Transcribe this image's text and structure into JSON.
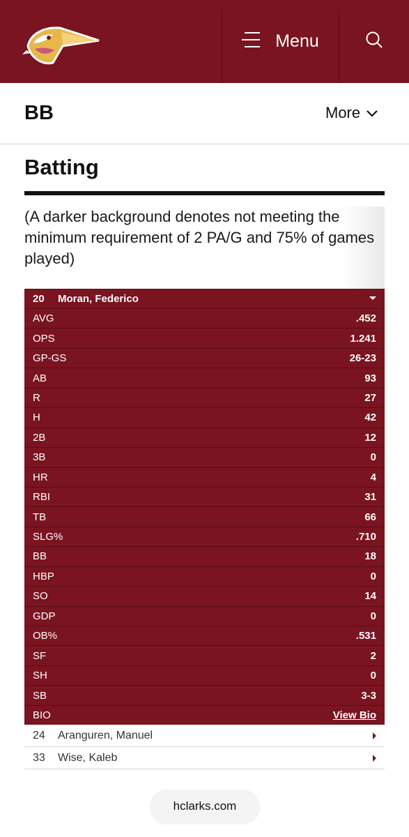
{
  "header": {
    "menu_label": "Menu",
    "brand_color": "#7a1420"
  },
  "subnav": {
    "title": "BB",
    "more_label": "More"
  },
  "section": {
    "title": "Batting",
    "note": "(A darker background denotes not meeting the minimum requirement of 2 PA/G and 75% of games played)"
  },
  "player": {
    "number": "20",
    "name": "Moran, Federico",
    "stats": [
      {
        "label": "AVG",
        "value": ".452"
      },
      {
        "label": "OPS",
        "value": "1.241"
      },
      {
        "label": "GP-GS",
        "value": "26-23"
      },
      {
        "label": "AB",
        "value": "93"
      },
      {
        "label": "R",
        "value": "27"
      },
      {
        "label": "H",
        "value": "42"
      },
      {
        "label": "2B",
        "value": "12"
      },
      {
        "label": "3B",
        "value": "0"
      },
      {
        "label": "HR",
        "value": "4"
      },
      {
        "label": "RBI",
        "value": "31"
      },
      {
        "label": "TB",
        "value": "66"
      },
      {
        "label": "SLG%",
        "value": ".710"
      },
      {
        "label": "BB",
        "value": "18"
      },
      {
        "label": "HBP",
        "value": "0"
      },
      {
        "label": "SO",
        "value": "14"
      },
      {
        "label": "GDP",
        "value": "0"
      },
      {
        "label": "OB%",
        "value": ".531"
      },
      {
        "label": "SF",
        "value": "2"
      },
      {
        "label": "SH",
        "value": "0"
      },
      {
        "label": "SB",
        "value": "3-3"
      }
    ],
    "bio_label": "BIO",
    "bio_link": "View Bio"
  },
  "other_players": [
    {
      "number": "24",
      "name": "Aranguren, Manuel"
    },
    {
      "number": "33",
      "name": "Wise, Kaleb"
    }
  ],
  "browser": {
    "url": "hclarks.com"
  }
}
